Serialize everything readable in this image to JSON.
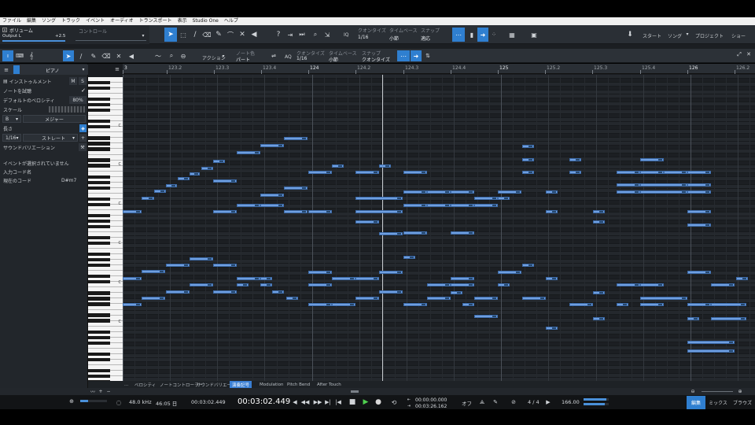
{
  "menu": [
    "ファイル",
    "編集",
    "ソング",
    "トラック",
    "イベント",
    "オーディオ",
    "トランスポート",
    "表示",
    "Studio One",
    "ヘルプ"
  ],
  "header": {
    "track_label": "ボリューム",
    "track_sub": "Output L",
    "vol_value": "+2.5",
    "control_label": "コントロール",
    "quantize_title": "クオンタイズ",
    "quantize_value": "1/16",
    "timebase_title": "タイムベース",
    "timebase_value": "小節",
    "snap_title": "スナップ",
    "snap_value": "適応",
    "iq": "IQ",
    "start": "スタート",
    "song": "ソング",
    "project": "プロジェクト",
    "show": "ショー"
  },
  "editor_toolbar": {
    "action": "アクション",
    "note_color_title": "ノート色",
    "note_color_value": "パート",
    "aq": "AQ",
    "quantize_title": "クオンタイズ",
    "quantize_value": "1/16",
    "timebase_title": "タイムベース",
    "timebase_value": "小節",
    "snap_title": "スナップ",
    "snap_value": "クオンタイズ"
  },
  "inspector": {
    "instrument_name": "ピアノ",
    "instrument_label": "インストゥルメント",
    "m": "M",
    "s": "S",
    "note_preview": "ノートを試聴",
    "default_velocity_label": "デフォルトのベロシティ",
    "default_velocity_value": "80%",
    "scale_label": "スケール",
    "scale_root": "B",
    "scale_type": "メジャー",
    "length_label": "長さ",
    "length_value": "1/16",
    "length_mode": "ストレート",
    "sound_variation": "サウンドバリエーション",
    "no_event": "イベントが選択されていません",
    "input_chord": "入力コード名",
    "current_chord_label": "現在のコード",
    "current_chord_value": "D#m7"
  },
  "ruler": [
    "3",
    "123.2",
    "123.3",
    "123.4",
    "124",
    "124.2",
    "124.3",
    "124.4",
    "125",
    "125.2",
    "125.3",
    "125.4",
    "126",
    "126.2"
  ],
  "keyboard_labels": [
    "C",
    "C",
    "C",
    "C",
    "C",
    "C"
  ],
  "lanes": [
    "ベロシティ",
    "ノートコントローラー",
    "サウンドバリエーション",
    "演奏記号",
    "Modulation",
    "Pitch Bend",
    "After Touch"
  ],
  "lanes_more": "...",
  "transport": {
    "sample_rate": "48.0 kHz",
    "record_time": "46:05 日",
    "time_small": "00:03:02.449",
    "time_main": "00:03:02.449",
    "loop_start": "00:00:00.000",
    "loop_end": "00:03:26.162",
    "off": "オフ",
    "signature": "4 / 4",
    "tempo": "166.00",
    "edit": "編集",
    "mix": "ミックス",
    "browse": "ブラウズ"
  },
  "accent_color": "#2f7fd0",
  "note_color": "#6f9fe0"
}
